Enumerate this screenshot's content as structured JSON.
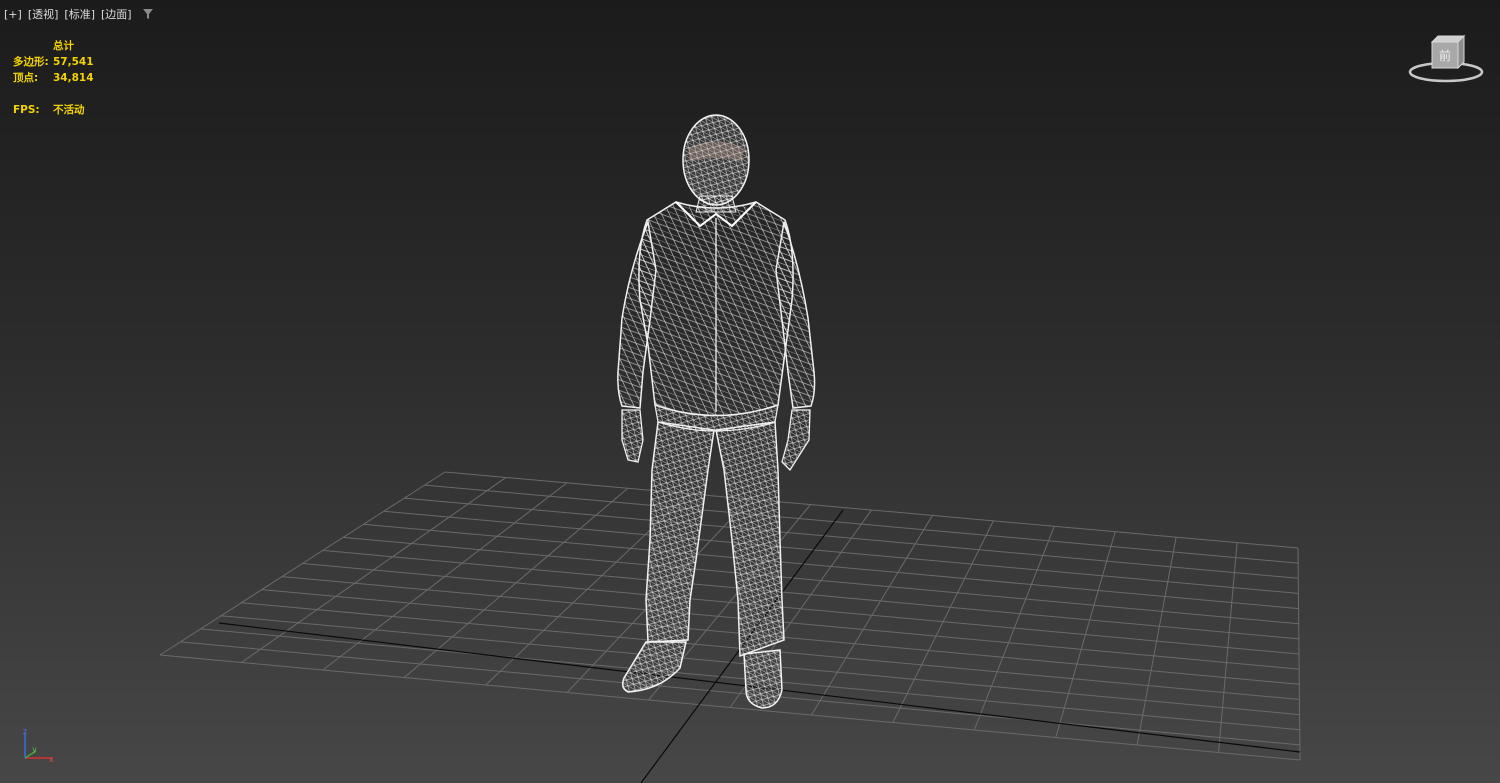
{
  "viewport": {
    "labels": [
      "[+]",
      "[透视]",
      "[标准]",
      "[边面]"
    ],
    "filter_icon": "filter-icon"
  },
  "stats": {
    "header": "总计",
    "polygons_label": "多边形:",
    "polygons_value": "57,541",
    "vertices_label": "顶点:",
    "vertices_value": "34,814",
    "fps_label": "FPS:",
    "fps_value": "不活动"
  },
  "viewcube": {
    "face_label": "前",
    "icon": "viewcube-icon"
  },
  "axis_tripod": {
    "z": "z",
    "y": "y",
    "x": "x"
  },
  "colors": {
    "stats_text": "#f2d200",
    "wireframe": "#f0f0f0",
    "grid": "#6a6a6a",
    "axis_line": "#0a0a0a"
  }
}
